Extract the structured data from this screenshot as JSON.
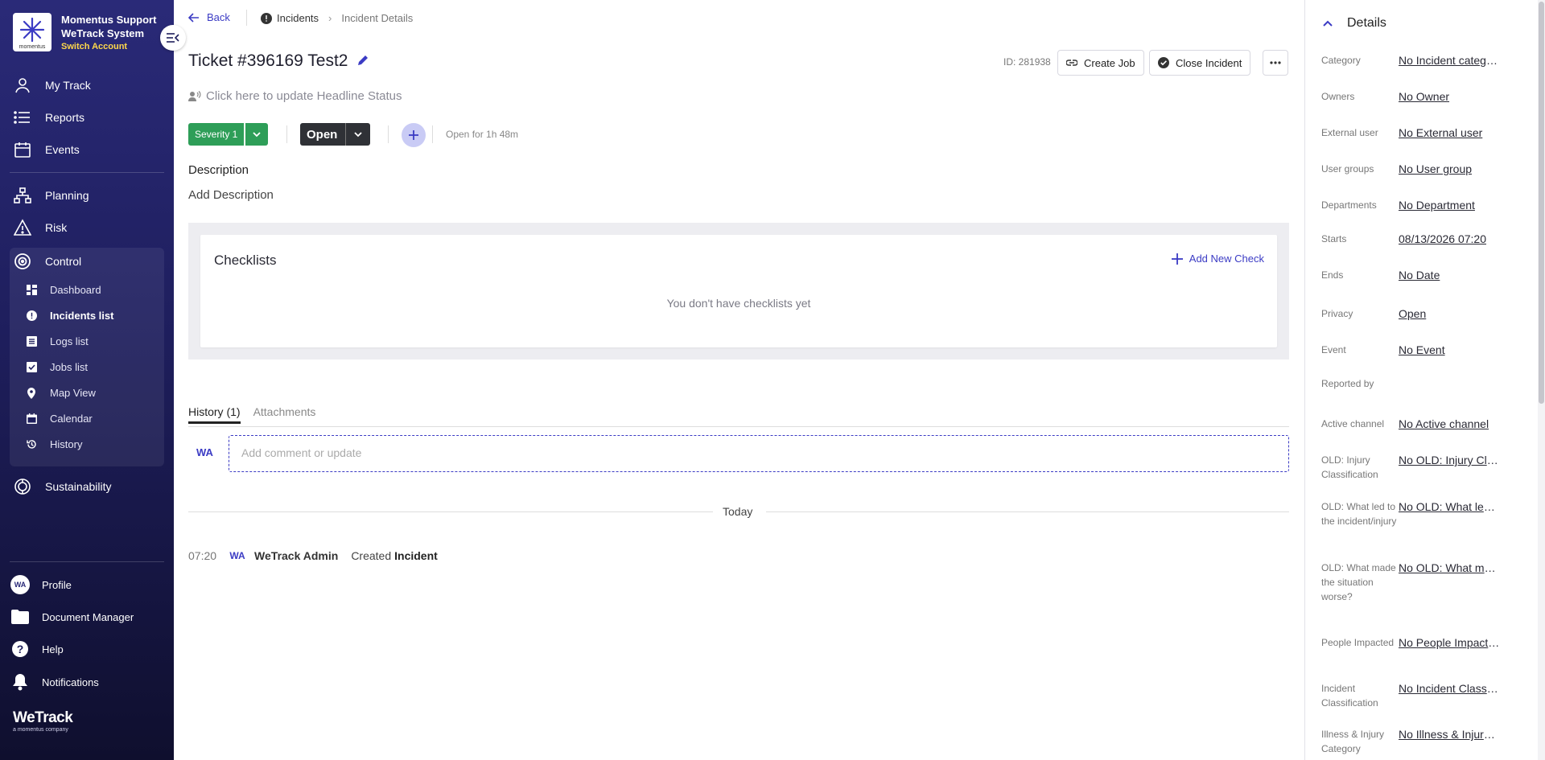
{
  "sidebar": {
    "brand": {
      "line1": "Momentus Support",
      "line2": "WeTrack System",
      "switch": "Switch Account",
      "logo_text": "momentus"
    },
    "nav": [
      {
        "label": "My Track",
        "icon": "user-icon"
      },
      {
        "label": "Reports",
        "icon": "list-icon"
      },
      {
        "label": "Events",
        "icon": "calendar-icon"
      },
      {
        "label": "Planning",
        "icon": "hierarchy-icon"
      },
      {
        "label": "Risk",
        "icon": "warning-icon"
      },
      {
        "label": "Control",
        "icon": "target-icon"
      }
    ],
    "control_sub": [
      {
        "label": "Dashboard",
        "icon": "dashboard-icon"
      },
      {
        "label": "Incidents list",
        "icon": "alert-icon",
        "active": true
      },
      {
        "label": "Logs list",
        "icon": "log-icon"
      },
      {
        "label": "Jobs list",
        "icon": "checkbox-icon"
      },
      {
        "label": "Map View",
        "icon": "pin-icon"
      },
      {
        "label": "Calendar",
        "icon": "calendar-icon"
      },
      {
        "label": "History",
        "icon": "history-icon"
      }
    ],
    "sustainability": "Sustainability",
    "bottom": [
      {
        "label": "Profile",
        "avatar": "WA"
      },
      {
        "label": "Document Manager",
        "icon": "folder-icon"
      },
      {
        "label": "Help",
        "icon": "help-icon"
      },
      {
        "label": "Notifications",
        "icon": "bell-icon"
      }
    ],
    "footer_logo": {
      "name": "WeTrack",
      "sub": "a momentus company"
    }
  },
  "header": {
    "back": "Back",
    "breadcrumb": {
      "first": "Incidents",
      "second": "Incident Details"
    },
    "title": "Ticket #396169 Test2",
    "id_text": "ID: 281938",
    "create_job": "Create Job",
    "close_incident": "Close Incident"
  },
  "headline": "Click here to update Headline Status",
  "severity": "Severity 1",
  "status": "Open",
  "open_for": "Open for 1h 48m",
  "description": {
    "label": "Description",
    "placeholder": "Add Description"
  },
  "checklists": {
    "title": "Checklists",
    "add": "Add New Check",
    "empty": "You don't have checklists yet"
  },
  "tabs": [
    {
      "label": "History (1)",
      "active": true
    },
    {
      "label": "Attachments",
      "active": false
    }
  ],
  "comment": {
    "avatar": "WA",
    "placeholder": "Add comment or update"
  },
  "history": {
    "day": "Today",
    "entries": [
      {
        "time": "07:20",
        "avatar": "WA",
        "user": "WeTrack Admin",
        "action": "Created",
        "object": "Incident"
      }
    ]
  },
  "details": {
    "title": "Details",
    "rows": [
      {
        "label": "Category",
        "value": "No Incident category"
      },
      {
        "label": "Owners",
        "value": "No Owner"
      },
      {
        "label": "External user",
        "value": "No External user"
      },
      {
        "label": "User groups",
        "value": "No User group"
      },
      {
        "label": "Departments",
        "value": "No Department"
      },
      {
        "label": "Starts",
        "value": "08/13/2026 07:20"
      },
      {
        "label": "Ends",
        "value": "No Date"
      },
      {
        "label": "Privacy",
        "value": "Open"
      },
      {
        "label": "Event",
        "value": "No Event"
      },
      {
        "label": "Reported by",
        "value": ""
      },
      {
        "label": "Active channel",
        "value": "No Active channel"
      },
      {
        "label": "OLD: Injury Classification",
        "value": "No OLD: Injury Classification"
      },
      {
        "label": "OLD: What led to the incident/injury",
        "value": "No OLD: What led to the incident/injury"
      },
      {
        "label": "OLD: What made the situation worse?",
        "value": "No OLD: What made the situation worse?"
      },
      {
        "label": "People Impacted",
        "value": "No People Impacted"
      },
      {
        "label": "Incident Classification",
        "value": "No Incident Classification"
      },
      {
        "label": "Illness & Injury Category",
        "value": "No Illness & Injury Category"
      }
    ]
  },
  "colors": {
    "sidebar": "#1e1e5c",
    "accent": "#3b3bc4",
    "severity": "#2e9e58",
    "status": "#2f3136"
  }
}
